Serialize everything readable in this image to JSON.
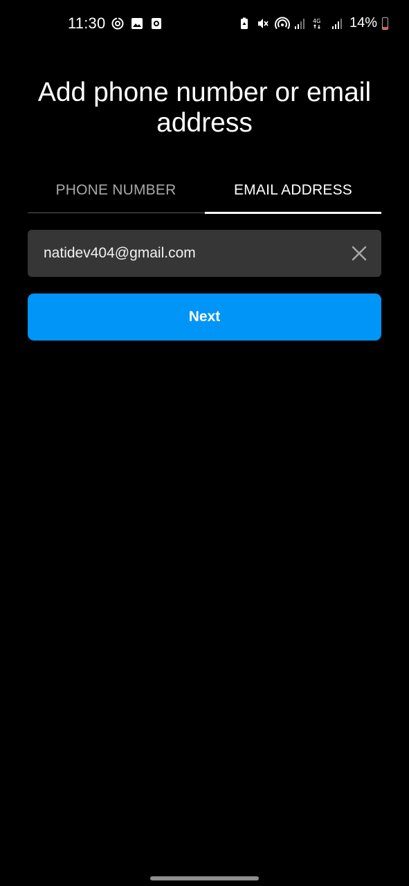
{
  "status_bar": {
    "time": "11:30",
    "battery_percent": "14%",
    "left_icons": [
      "sync-icon",
      "gallery-icon",
      "screenshot-icon"
    ],
    "right_icons": [
      "battery-saver-icon",
      "mute-icon",
      "hotspot-icon",
      "signal-icon",
      "4g-icon",
      "signal-icon",
      "battery-icon"
    ],
    "battery_color": "#e8533a"
  },
  "title": "Add phone number or email address",
  "tabs": [
    {
      "label": "PHONE NUMBER",
      "selected": false
    },
    {
      "label": "EMAIL ADDRESS",
      "selected": true
    }
  ],
  "email_field": {
    "value": "natidev404@gmail.com",
    "clear_icon": "close-icon"
  },
  "next_button": {
    "label": "Next",
    "color": "#0095f6"
  }
}
